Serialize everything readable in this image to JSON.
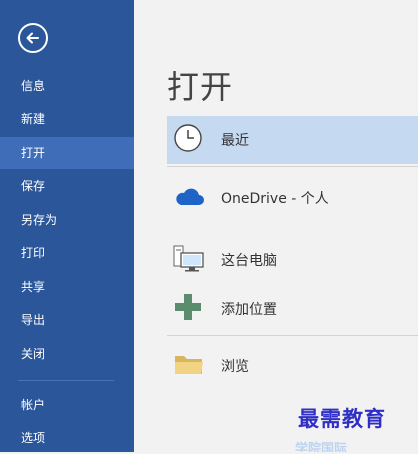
{
  "sidebar": {
    "items": [
      {
        "label": "信息"
      },
      {
        "label": "新建"
      },
      {
        "label": "打开"
      },
      {
        "label": "保存"
      },
      {
        "label": "另存为"
      },
      {
        "label": "打印"
      },
      {
        "label": "共享"
      },
      {
        "label": "导出"
      },
      {
        "label": "关闭"
      },
      {
        "label": "帐户"
      },
      {
        "label": "选项"
      }
    ],
    "active_item": "打开"
  },
  "main": {
    "title": "打开",
    "locations": [
      {
        "label": "最近",
        "icon": "clock-icon"
      },
      {
        "label": "OneDrive - 个人",
        "icon": "cloud-icon"
      },
      {
        "label": "这台电脑",
        "icon": "computer-icon"
      },
      {
        "label": "添加位置",
        "icon": "plus-icon"
      },
      {
        "label": "浏览",
        "icon": "folder-icon"
      }
    ]
  },
  "watermark": {
    "text": "最需教育",
    "subtext": "学院国际"
  },
  "colors": {
    "sidebar": "#2b579a",
    "sidebar_active": "#3f6db8",
    "selected": "#c5d9f1",
    "cloud": "#1e64c8",
    "plus": "#5b8c6e",
    "folder": "#e8c777",
    "watermark": "#2f2fc8"
  }
}
